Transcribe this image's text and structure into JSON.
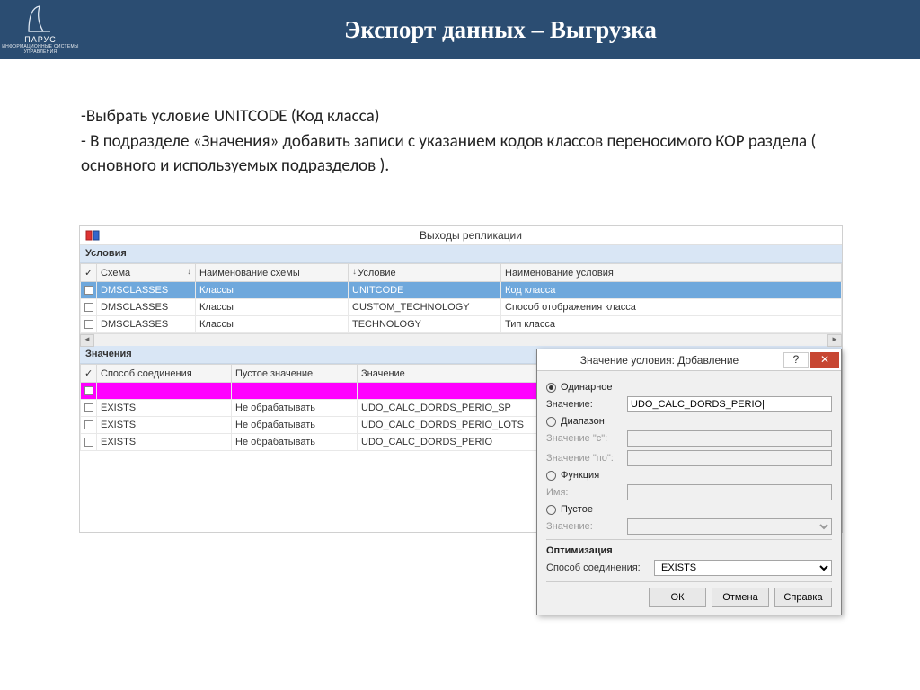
{
  "header": {
    "logo_text": "ПАРУС",
    "logo_sub": "ИНФОРМАЦИОННЫЕ СИСТЕМЫ УПРАВЛЕНИЯ",
    "title": "Экспорт данных – Выгрузка"
  },
  "bullets": {
    "b1": "-Выбрать условие UNITCODE (Код класса)",
    "b2": "- В подразделе «Значения» добавить записи с указанием кодов классов переносимого КОР раздела ( основного и используемых подразделов )."
  },
  "app": {
    "window_title": "Выходы репликации",
    "section1": "Условия",
    "section2": "Значения",
    "cols1": {
      "c0": "",
      "c1": "Схема",
      "c2": "Наименование схемы",
      "c3": "Условие",
      "c4": "Наименование условия"
    },
    "rows1": [
      {
        "c0": "",
        "c1": "DMSCLASSES",
        "c2": "Классы",
        "c3": "UNITCODE",
        "c4": "Код класса",
        "sel": true
      },
      {
        "c0": "",
        "c1": "DMSCLASSES",
        "c2": "Классы",
        "c3": "CUSTOM_TECHNOLOGY",
        "c4": "Способ отображения класса"
      },
      {
        "c0": "",
        "c1": "DMSCLASSES",
        "c2": "Классы",
        "c3": "TECHNOLOGY",
        "c4": "Тип класса"
      }
    ],
    "cols2": {
      "c0": "",
      "c1": "Способ соединения",
      "c2": "Пустое значение",
      "c3": "Значение"
    },
    "rows2": [
      {
        "c0": "",
        "c1": "",
        "c2": "",
        "c3": "",
        "magenta": true
      },
      {
        "c0": "",
        "c1": "EXISTS",
        "c2": "Не обрабатывать",
        "c3": "UDO_CALC_DORDS_PERIO_SP"
      },
      {
        "c0": "",
        "c1": "EXISTS",
        "c2": "Не обрабатывать",
        "c3": "UDO_CALC_DORDS_PERIO_LOTS"
      },
      {
        "c0": "",
        "c1": "EXISTS",
        "c2": "Не обрабатывать",
        "c3": "UDO_CALC_DORDS_PERIO"
      }
    ]
  },
  "dialog": {
    "title": "Значение условия: Добавление",
    "r_single": "Одинарное",
    "value_lbl": "Значение:",
    "value_val": "UDO_CALC_DORDS_PERIO|",
    "r_range": "Диапазон",
    "from_lbl": "Значение \"с\":",
    "to_lbl": "Значение \"по\":",
    "r_func": "Функция",
    "name_lbl": "Имя:",
    "r_empty": "Пустое",
    "empty_lbl": "Значение:",
    "opt_head": "Оптимизация",
    "join_lbl": "Способ соединения:",
    "join_val": "EXISTS",
    "ok": "ОК",
    "cancel": "Отмена",
    "help": "Справка"
  }
}
